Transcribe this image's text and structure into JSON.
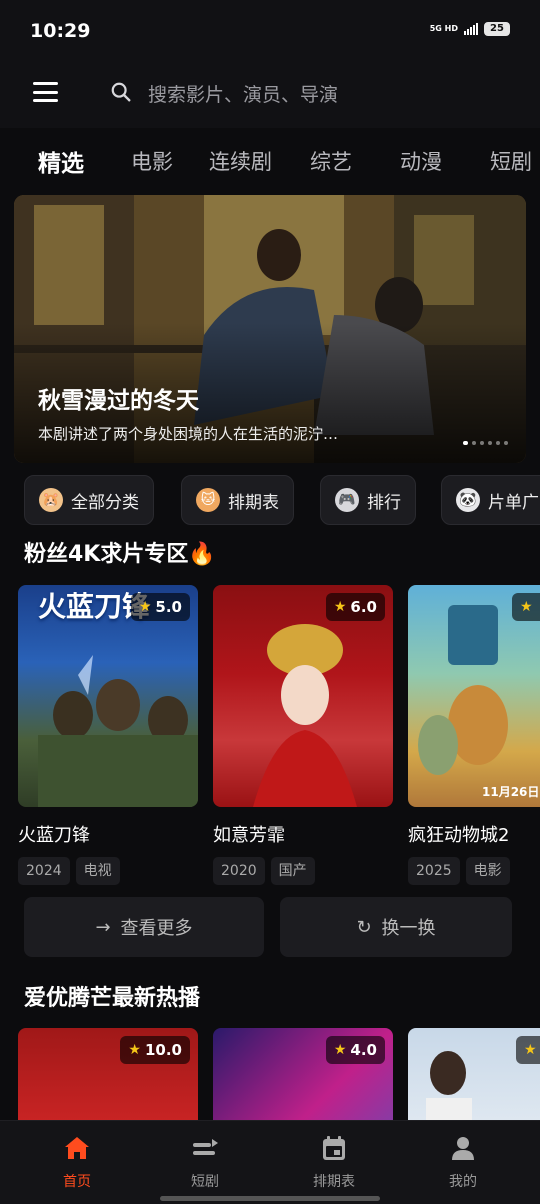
{
  "status": {
    "time": "10:29",
    "network": "5G HD",
    "battery": "25"
  },
  "search": {
    "placeholder": "搜索影片、演员、导演"
  },
  "categories": [
    "精选",
    "电影",
    "连续剧",
    "综艺",
    "动漫",
    "短剧"
  ],
  "banner": {
    "title": "秋雪漫过的冬天",
    "description": "本剧讲述了两个身处困境的人在生活的泥泞…"
  },
  "quick_links": [
    {
      "label": "全部分类",
      "icon": "hamster-icon"
    },
    {
      "label": "排期表",
      "icon": "cat-icon"
    },
    {
      "label": "排行",
      "icon": "gamepad-icon"
    },
    {
      "label": "片单广",
      "icon": "panda-icon"
    }
  ],
  "section1": {
    "title": "粉丝4K求片专区🔥",
    "items": [
      {
        "title": "火蓝刀锋",
        "rating": "5.0",
        "year": "2024",
        "type": "电视",
        "poster_text": "火蓝刀锋"
      },
      {
        "title": "如意芳霏",
        "rating": "6.0",
        "year": "2020",
        "type": "国产",
        "poster_text": ""
      },
      {
        "title": "疯狂动物城2",
        "rating": "",
        "year": "2025",
        "type": "电影",
        "poster_text": "11月26日"
      }
    ],
    "more_label": "查看更多",
    "refresh_label": "换一换"
  },
  "section2": {
    "title": "爱优腾芒最新热播",
    "items": [
      {
        "rating": "10.0"
      },
      {
        "rating": "4.0"
      },
      {
        "rating": ""
      }
    ]
  },
  "tabbar": [
    {
      "label": "首页",
      "icon": "home-icon",
      "active": true
    },
    {
      "label": "短剧",
      "icon": "short-drama-icon",
      "active": false
    },
    {
      "label": "排期表",
      "icon": "calendar-icon",
      "active": false
    },
    {
      "label": "我的",
      "icon": "user-icon",
      "active": false
    }
  ],
  "colors": {
    "accent": "#ff4c1e",
    "background": "#0c0c0e",
    "surface": "#1c1c20",
    "star": "#f5c518"
  }
}
